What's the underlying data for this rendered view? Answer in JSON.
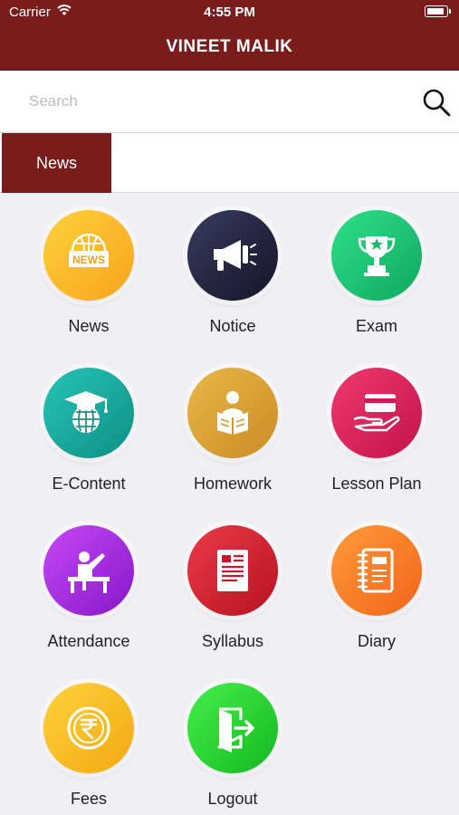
{
  "status_bar": {
    "carrier": "Carrier",
    "time": "4:55 PM"
  },
  "header": {
    "title": "VINEET MALIK"
  },
  "search": {
    "placeholder": "Search",
    "value": ""
  },
  "tabs": [
    {
      "label": "News",
      "active": true
    }
  ],
  "menu": [
    {
      "label": "News",
      "icon": "news-globe-icon",
      "colors": [
        "#ffd23a",
        "#f7a31c"
      ]
    },
    {
      "label": "Notice",
      "icon": "megaphone-icon",
      "colors": [
        "#3a3a5e",
        "#141428"
      ]
    },
    {
      "label": "Exam",
      "icon": "trophy-icon",
      "colors": [
        "#30e08a",
        "#0fa860"
      ]
    },
    {
      "label": "E-Content",
      "icon": "graduation-globe-icon",
      "colors": [
        "#26c4b4",
        "#0e8f86"
      ]
    },
    {
      "label": "Homework",
      "icon": "reading-student-icon",
      "colors": [
        "#e8b84a",
        "#cc8a23"
      ]
    },
    {
      "label": "Lesson Plan",
      "icon": "hand-card-icon",
      "colors": [
        "#f0386e",
        "#c3134b"
      ]
    },
    {
      "label": "Attendance",
      "icon": "student-desk-icon",
      "colors": [
        "#c549f5",
        "#8717c9"
      ]
    },
    {
      "label": "Syllabus",
      "icon": "document-icon",
      "colors": [
        "#ec3a4a",
        "#b6121f"
      ]
    },
    {
      "label": "Diary",
      "icon": "notebook-icon",
      "colors": [
        "#ff9b3a",
        "#f2641a"
      ]
    },
    {
      "label": "Fees",
      "icon": "rupee-coin-icon",
      "colors": [
        "#ffd23a",
        "#f2a812"
      ]
    },
    {
      "label": "Logout",
      "icon": "exit-door-icon",
      "colors": [
        "#45f04a",
        "#13b820"
      ]
    }
  ]
}
